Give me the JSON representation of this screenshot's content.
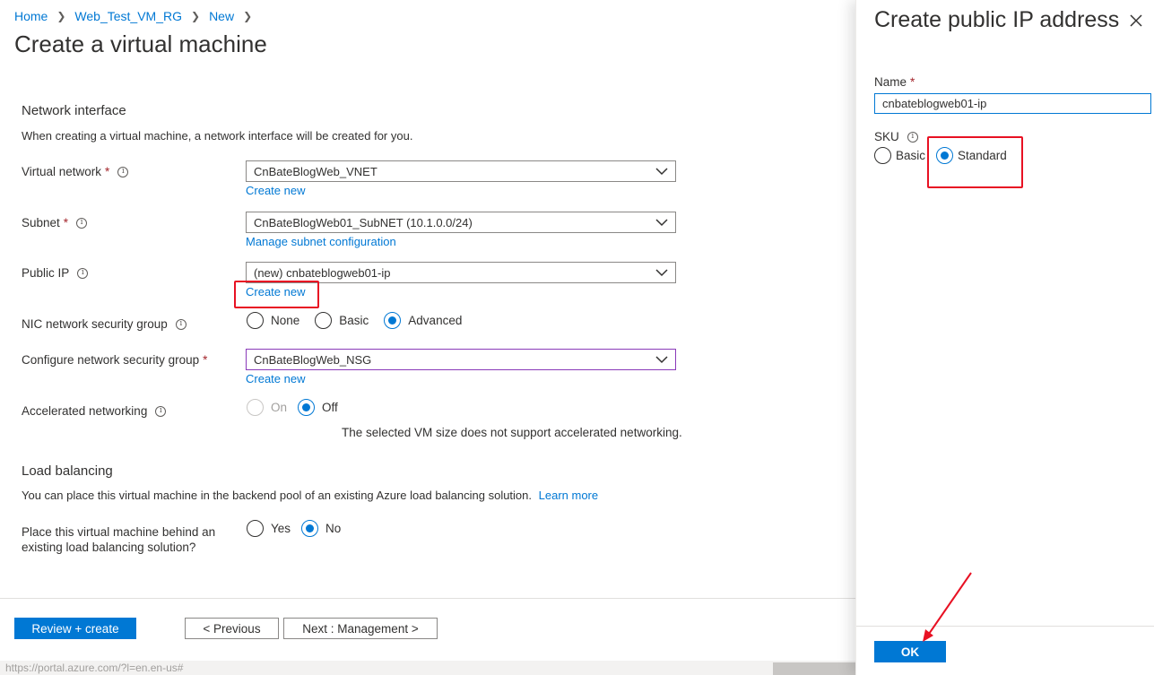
{
  "breadcrumb": {
    "home": "Home",
    "rg": "Web_Test_VM_RG",
    "new": "New"
  },
  "page_title": "Create a virtual machine",
  "network_interface": {
    "title": "Network interface",
    "description": "When creating a virtual machine, a network interface will be created for you.",
    "virtual_network": {
      "label": "Virtual network",
      "value": "CnBateBlogWeb_VNET",
      "link": "Create new"
    },
    "subnet": {
      "label": "Subnet",
      "value": "CnBateBlogWeb01_SubNET (10.1.0.0/24)",
      "link": "Manage subnet configuration"
    },
    "public_ip": {
      "label": "Public IP",
      "value": "(new) cnbateblogweb01-ip",
      "link": "Create new"
    },
    "nic_nsg": {
      "label": "NIC network security group",
      "options": [
        "None",
        "Basic",
        "Advanced"
      ],
      "selected": "Advanced"
    },
    "configure_nsg": {
      "label": "Configure network security group",
      "value": "CnBateBlogWeb_NSG",
      "link": "Create new"
    },
    "accelerated": {
      "label": "Accelerated networking",
      "options": [
        "On",
        "Off"
      ],
      "selected": "Off",
      "note": "The selected VM size does not support accelerated networking."
    }
  },
  "load_balancing": {
    "title": "Load balancing",
    "description": "You can place this virtual machine in the backend pool of an existing Azure load balancing solution.",
    "learn_more": "Learn more",
    "question_line1": "Place this virtual machine behind an",
    "question_line2": "existing load balancing solution?",
    "options": [
      "Yes",
      "No"
    ],
    "selected": "No"
  },
  "footer": {
    "review_create": "Review + create",
    "previous": "< Previous",
    "next": "Next : Management >"
  },
  "statusbar": {
    "url": "https://portal.azure.com/?l=en.en-us#"
  },
  "panel": {
    "title": "Create public IP address",
    "name_label": "Name",
    "name_value": "cnbateblogweb01-ip",
    "sku_label": "SKU",
    "sku_options": [
      "Basic",
      "Standard"
    ],
    "sku_selected": "Standard",
    "ok": "OK"
  },
  "colors": {
    "accent": "#0078d4",
    "annotation": "#e81123",
    "required": "#a4262c"
  },
  "icons": {
    "info": "info-icon",
    "chevron": "chevron-down-icon",
    "close": "close-icon",
    "breadcrumb_sep": "chevron-right-icon"
  }
}
